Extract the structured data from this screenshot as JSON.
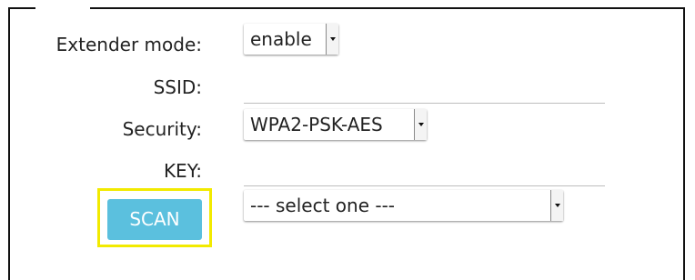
{
  "form": {
    "extender_mode": {
      "label": "Extender mode:",
      "value": "enable"
    },
    "ssid": {
      "label": "SSID:",
      "value": ""
    },
    "security": {
      "label": "Security:",
      "value": "WPA2-PSK-AES"
    },
    "key": {
      "label": "KEY:",
      "value": ""
    },
    "scan": {
      "button_label": "SCAN",
      "network_select": "--- select one ---"
    }
  },
  "colors": {
    "scan_button": "#5bc0de",
    "highlight": "#f2ea00",
    "frame_border": "#111111"
  },
  "icons": {
    "dropdown": "chevron-down-icon"
  }
}
